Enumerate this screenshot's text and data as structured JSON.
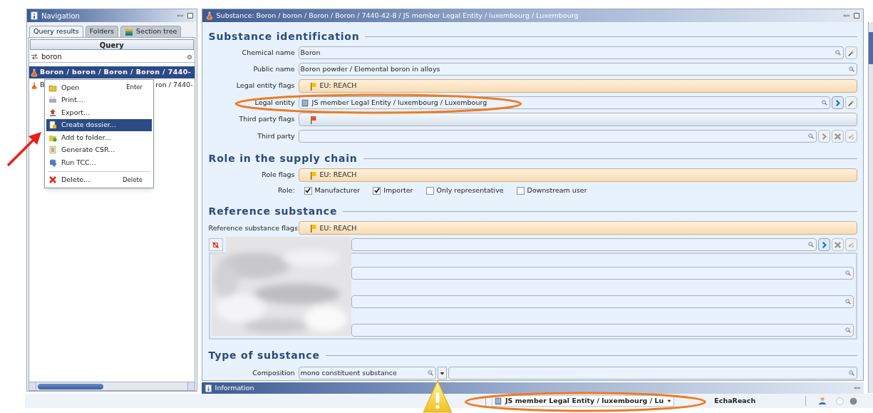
{
  "navigation": {
    "title": "Navigation",
    "tabs": [
      {
        "label": "Query results",
        "selected": true
      },
      {
        "label": "Folders",
        "selected": false
      },
      {
        "label": "Section tree",
        "selected": false
      }
    ],
    "query_button": "Query",
    "search": {
      "value": "boron"
    },
    "results": [
      {
        "text": "Boron / boron / Boron / Boron / 7440-",
        "selected": true
      },
      {
        "text_start": "B",
        "text_end": "ron / 7440-",
        "selected": false
      }
    ],
    "context_menu": [
      {
        "kind": "item",
        "label": "Open",
        "shortcut": "Enter",
        "selected": false
      },
      {
        "kind": "item",
        "label": "Print...",
        "selected": false
      },
      {
        "kind": "item",
        "label": "Export...",
        "selected": false
      },
      {
        "kind": "item",
        "label": "Create dossier...",
        "selected": true
      },
      {
        "kind": "item",
        "label": "Add to folder...",
        "selected": false
      },
      {
        "kind": "item",
        "label": "Generate CSR...",
        "selected": false
      },
      {
        "kind": "item",
        "label": "Run TCC...",
        "selected": false
      },
      {
        "kind": "separator"
      },
      {
        "kind": "item",
        "label": "Delete...",
        "shortcut": "Delete",
        "selected": false
      }
    ]
  },
  "editor": {
    "title": "Substance: Boron / boron / Boron / Boron / 7440-42-8 / JS member Legal Entity / luxembourg / Luxembourg",
    "sections": [
      {
        "title": "Substance identification",
        "rows": [
          {
            "kind": "field",
            "label": "Chemical name",
            "value": "Boron",
            "buttons": [
              {
                "kind": "wand"
              }
            ]
          },
          {
            "kind": "field",
            "label": "Public name",
            "value": "Boron powder /  Elemental boron in alloys"
          },
          {
            "kind": "flags",
            "label": "Legal entity flags",
            "value": "EU: REACH",
            "color": "#f5c400",
            "highlighted": true
          },
          {
            "kind": "field",
            "label": "Legal entity",
            "value": "JS member Legal Entity / luxembourg / Luxembourg",
            "entity": true,
            "buttons": [
              {
                "kind": "go",
                "enabled": true
              },
              {
                "kind": "wand"
              }
            ]
          },
          {
            "kind": "flags",
            "label": "Third party flags",
            "color": "#e8502a",
            "highlighted": false
          },
          {
            "kind": "field",
            "label": "Third party",
            "buttons": [
              {
                "kind": "go",
                "enabled": false
              },
              {
                "kind": "delete"
              },
              {
                "kind": "link"
              }
            ]
          }
        ]
      },
      {
        "title": "Role in the supply chain",
        "rows": [
          {
            "kind": "flags",
            "label": "Role flags",
            "value": "EU: REACH",
            "color": "#f5c400",
            "highlighted": true
          },
          {
            "kind": "checks",
            "label": "Role:",
            "options": [
              {
                "label": "Manufacturer",
                "checked": true
              },
              {
                "label": "Importer",
                "checked": true
              },
              {
                "label": "Only representative",
                "checked": false
              },
              {
                "label": "Downstream user",
                "checked": false
              }
            ]
          }
        ]
      },
      {
        "title": "Reference substance",
        "rows": [
          {
            "kind": "flags",
            "label": "Reference substance flags",
            "value": "EU: REACH",
            "color": "#f5c400",
            "highlighted": true
          },
          {
            "kind": "reference",
            "buttons": [
              {
                "kind": "go",
                "enabled": true
              },
              {
                "kind": "delete"
              },
              {
                "kind": "link"
              }
            ]
          }
        ]
      },
      {
        "title": "Type of substance",
        "rows": [
          {
            "kind": "composition",
            "label": "Composition",
            "value": "mono constituent substance"
          }
        ]
      }
    ]
  },
  "information": {
    "title": "Information"
  },
  "status_bar": {
    "legal_entity": "JS member Legal Entity / luxembourg / Lu",
    "app": "EchaReach"
  }
}
